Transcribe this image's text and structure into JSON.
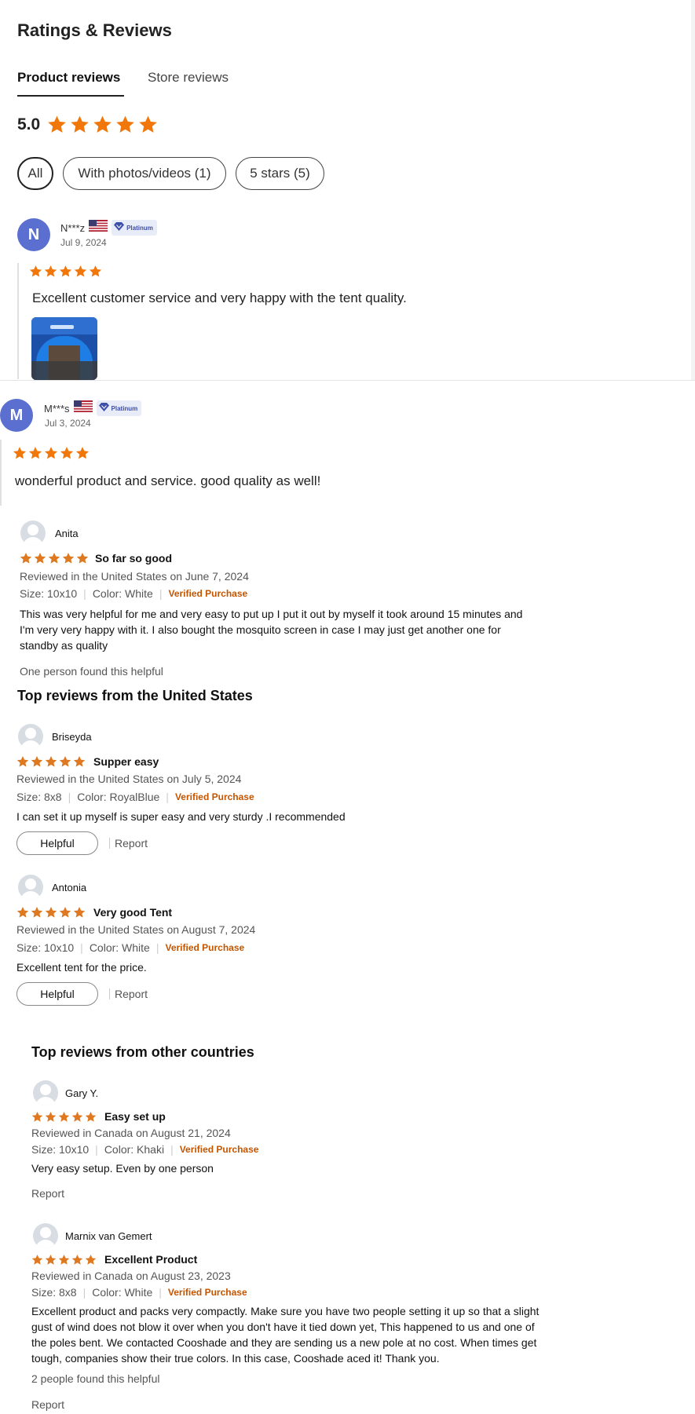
{
  "header": {
    "title": "Ratings & Reviews",
    "tabs": [
      "Product reviews",
      "Store reviews"
    ],
    "score": "5.0",
    "star_color": "#f2770a"
  },
  "filters": [
    "All",
    "With photos/videos (1)",
    "5 stars (5)"
  ],
  "temu_reviews": [
    {
      "initial": "N",
      "name": "N***z",
      "badge": "Platinum",
      "date": "Jul 9, 2024",
      "stars": 5,
      "text": "Excellent customer service and very happy with the tent quality.",
      "has_photo": true
    },
    {
      "initial": "M",
      "name": "M***s",
      "badge": "Platinum",
      "date": "Jul 3, 2024",
      "stars": 5,
      "text": "wonderful product and service. good quality as well!"
    }
  ],
  "amazon": {
    "star_color": "#de7921",
    "verified_color": "#c45500",
    "verified_label": "Verified Purchase",
    "helpful_label": "Helpful",
    "report_label": "Report",
    "headings": {
      "us": "Top reviews from the United States",
      "other": "Top reviews from other countries"
    },
    "reviews": [
      {
        "name": "Anita",
        "title": "So far so good",
        "reviewed": "Reviewed in the United States on June 7, 2024",
        "size": "Size: 10x10",
        "color": "Color: White",
        "body": [
          "This was very helpful for me and very easy to put up I put it out by myself it took around 15 minutes and",
          "I'm very very happy with it. I also bought the mosquito screen in case I may just get another one for",
          "standby as quality"
        ],
        "helpful_text": "One person found this helpful"
      },
      {
        "name": "Briseyda",
        "title": "Supper easy",
        "reviewed": "Reviewed in the United States on July 5, 2024",
        "size": "Size: 8x8",
        "color": "Color: RoyalBlue",
        "body": [
          "I can set it up myself is super easy and very sturdy .I recommended"
        ]
      },
      {
        "name": "Antonia",
        "title": "Very good Tent",
        "reviewed": "Reviewed in the United States on August 7, 2024",
        "size": "Size: 10x10",
        "color": "Color: White",
        "body": [
          "Excellent tent for the price."
        ]
      },
      {
        "name": "Gary Y.",
        "title": "Easy set up",
        "reviewed": "Reviewed in Canada on August 21, 2024",
        "size": "Size: 10x10",
        "color": "Color: Khaki",
        "body": [
          "Very easy setup. Even by one person"
        ]
      },
      {
        "name": "Marnix van Gemert",
        "title": "Excellent Product",
        "reviewed": "Reviewed in Canada on August 23, 2023",
        "size": "Size: 8x8",
        "color": "Color: White",
        "body": [
          "Excellent product and packs very compactly. Make sure you have two people setting it up so that a slight",
          "gust of wind does not blow it over when you don't have it tied down yet, This happened to us and one of",
          "the poles bent. We contacted Cooshade and they are sending us a new pole at no cost. When times get",
          "tough, companies show their true colors. In this case, Cooshade aced it! Thank you."
        ],
        "helpful_text": "2 people found this helpful"
      }
    ]
  }
}
